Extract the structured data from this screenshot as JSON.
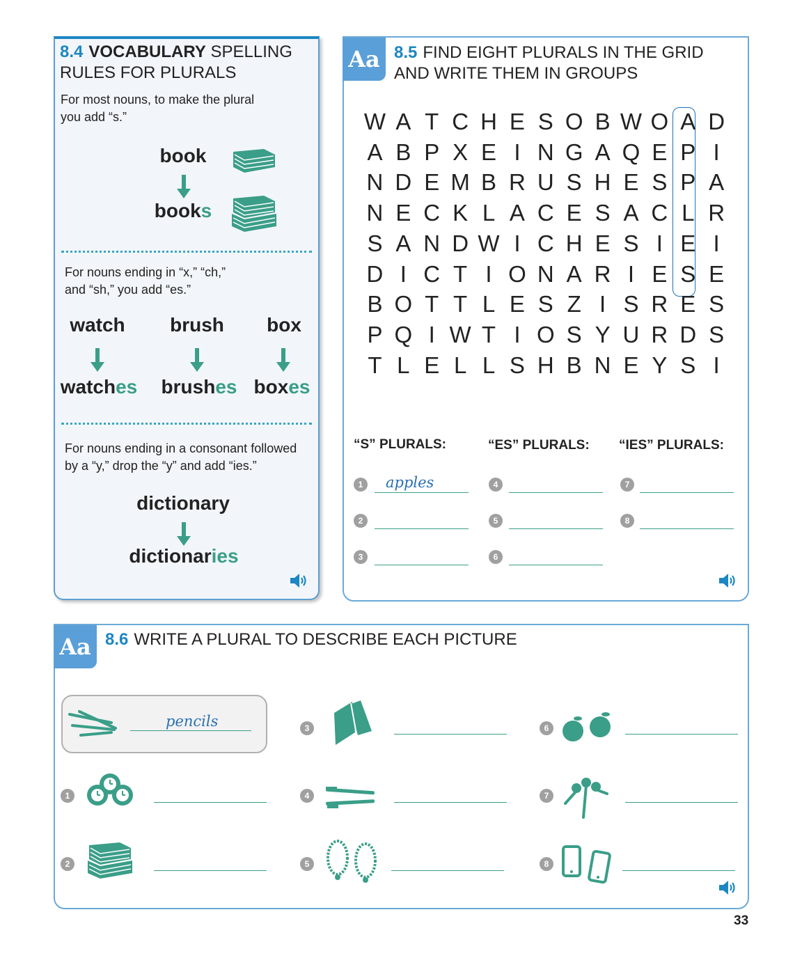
{
  "s84": {
    "num": "8.4",
    "title_bold": "VOCABULARY",
    "title_rest1": "SPELLING",
    "title_line2": "RULES FOR PLURALS",
    "rule1_l1": "For most nouns, to make the plural",
    "rule1_l2": "you add “s.”",
    "ex1_singular": "book",
    "ex1_plural_stem": "book",
    "ex1_plural_suffix": "s",
    "rule2_l1": "For nouns ending in “x,” “ch,”",
    "rule2_l2": "and “sh,” you add “es.”",
    "ex2": [
      {
        "singular": "watch",
        "stem": "watch",
        "suffix": "es"
      },
      {
        "singular": "brush",
        "stem": "brush",
        "suffix": "es"
      },
      {
        "singular": "box",
        "stem": "box",
        "suffix": "es"
      }
    ],
    "rule3_l1": "For nouns ending in a consonant followed",
    "rule3_l2": "by a “y,” drop the “y” and add “ies.”",
    "ex3_singular": "dictionary",
    "ex3_stem": "dictionar",
    "ex3_suffix": "ies"
  },
  "s85": {
    "badge": "Aa",
    "num": "8.5",
    "title_l1": "FIND EIGHT PLURALS IN THE GRID",
    "title_l2": "AND WRITE THEM IN GROUPS",
    "grid": [
      "WATCHESOBWOAD",
      "ABPXEINGAQEPI",
      "NDEMBRUSHESPA",
      "NECKLACESACLR",
      "SANDWICHESIEI",
      "DICTIONARIESE",
      "BOTTLESZISRES",
      "PQIWTIOSYURDS",
      "TLELLSHBNEYSI"
    ],
    "headers": [
      "“S” PLURALS:",
      "“ES” PLURALS:",
      "“IES” PLURALS:"
    ],
    "nums": [
      "1",
      "2",
      "3",
      "4",
      "5",
      "6",
      "7",
      "8"
    ],
    "answer1": "apples"
  },
  "s86": {
    "badge": "Aa",
    "num": "8.6",
    "title": "WRITE A PLURAL TO DESCRIBE EACH PICTURE",
    "example_answer": "pencils",
    "nums": [
      "1",
      "2",
      "3",
      "4",
      "5",
      "6",
      "7",
      "8"
    ],
    "pictures": [
      "pencils-icon",
      "watches-icon",
      "books-icon",
      "sandwiches-icon",
      "toothbrushes-icon",
      "necklaces-icon",
      "apples-icon",
      "keys-icon",
      "phones-icon"
    ]
  },
  "page_number": "33",
  "colors": {
    "accent_blue": "#1c87c2",
    "teal": "#3a9e88",
    "badge": "#5a9fd8"
  }
}
